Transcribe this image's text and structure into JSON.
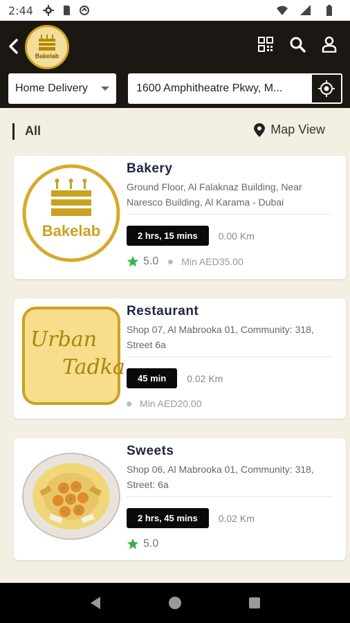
{
  "status": {
    "time": "2:44"
  },
  "header": {
    "logo_text": "Bakelab",
    "delivery_mode": "Home Delivery",
    "address": "1600 Amphitheatre Pkwy, M..."
  },
  "filter": {
    "label": "All",
    "map_view": "Map View"
  },
  "stores": [
    {
      "name": "Bakery",
      "logo_text": "Bakelab",
      "address": "Ground Floor, Al Falaknaz Building, Near Naresco Building, Al Karama - Dubai",
      "time": "2 hrs, 15 mins",
      "distance": "0.00 Km",
      "rating": "5.0",
      "min_order": "Min AED35.00"
    },
    {
      "name": "Restaurant",
      "logo_text_1": "Urban",
      "logo_text_2": "Tadka",
      "address": "Shop 07, Al Mabrooka 01, Community: 318, Street 6a",
      "time": "45 min",
      "distance": "0.02 Km",
      "min_order": "Min AED20.00"
    },
    {
      "name": "Sweets",
      "address": "Shop 06, Al Mabrooka 01, Community: 318, Street: 6a",
      "time": "2 hrs, 45 mins",
      "distance": "0.02 Km",
      "rating": "5.0"
    }
  ],
  "colors": {
    "header_bg": "#1b1712",
    "brand_gold": "#c9a21f",
    "page_bg": "#f3efe2",
    "star": "#3cb043"
  }
}
